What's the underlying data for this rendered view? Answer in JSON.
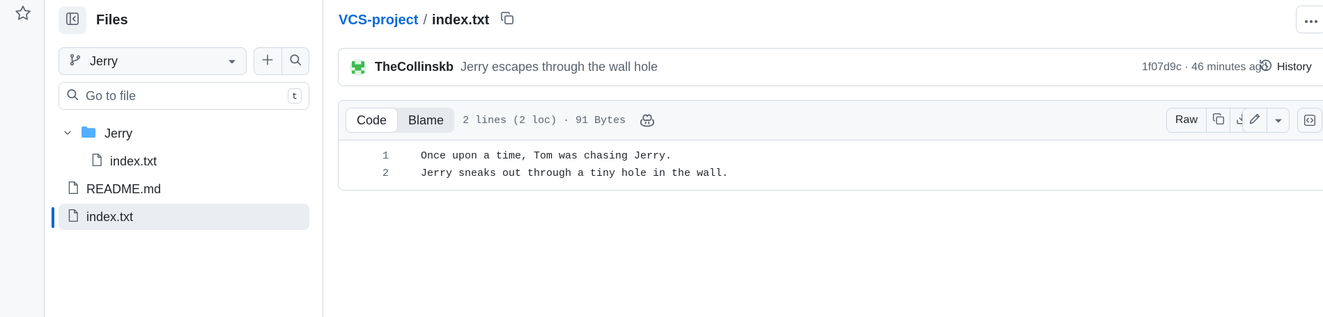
{
  "sidebar": {
    "title": "Files",
    "branch": "Jerry",
    "goto_placeholder": "Go to file",
    "goto_shortcut": "t",
    "tree": [
      {
        "label": "Jerry",
        "type": "folder",
        "expanded": true
      },
      {
        "label": "index.txt",
        "type": "file"
      },
      {
        "label": "README.md",
        "type": "file"
      },
      {
        "label": "index.txt",
        "type": "file",
        "selected": true
      }
    ]
  },
  "breadcrumb": {
    "repo": "VCS-project",
    "separator": "/",
    "file": "index.txt"
  },
  "commit": {
    "author": "TheCollinskb",
    "message": "Jerry escapes through the wall hole",
    "meta": "1f07d9c · 46 minutes ago",
    "history_label": "History"
  },
  "file_view": {
    "tabs": [
      "Code",
      "Blame"
    ],
    "active_tab": "Code",
    "stats": "2 lines (2 loc) · 91 Bytes",
    "raw_label": "Raw",
    "lines": [
      {
        "num": "1",
        "text": "Once upon a time, Tom was chasing Jerry."
      },
      {
        "num": "2",
        "text": "Jerry sneaks out through a tiny hole in the wall."
      }
    ]
  },
  "colors": {
    "accent": "#0969da",
    "folder": "#54aeff",
    "border": "#d1d9e0",
    "muted": "#59636e",
    "avatar": "#3fb950"
  }
}
